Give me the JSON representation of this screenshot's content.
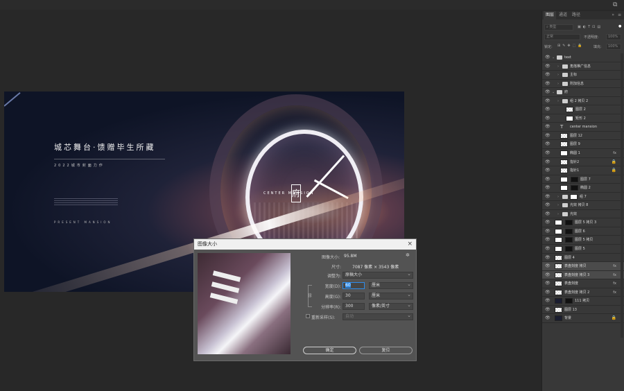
{
  "canvas": {
    "title": "城芯舞台·馈赠毕生所藏",
    "subtitle": "2022城市封面力作",
    "center_text": "CENTER MANSION",
    "logo_char": "府",
    "tagline": "PRESENT MANSION"
  },
  "dialog": {
    "title": "图像大小",
    "close": "×",
    "image_size_label": "图像大小:",
    "image_size_value": "95.8M",
    "dimensions_label": "尺寸:",
    "dimensions_value": "7087 像素  ×  3543 像素",
    "fit_label": "调整为:",
    "fit_value": "原稿大小",
    "width_label": "宽度(D):",
    "width_value": "60",
    "width_unit": "厘米",
    "height_label": "高度(G):",
    "height_value": "30",
    "height_unit": "厘米",
    "resolution_label": "分辨率(R):",
    "resolution_value": "300",
    "resolution_unit": "像素/英寸",
    "resample_label": "重新采样(S):",
    "resample_value": "自动",
    "ok": "确定",
    "cancel": "复位"
  },
  "panel": {
    "tabs": [
      "图层",
      "通道",
      "路径"
    ],
    "search_placeholder": "类型",
    "blend_mode": "正常",
    "opacity_label": "不透明度:",
    "opacity_value": "100%",
    "lock_label": "锁定:",
    "fill_label": "填充:",
    "fill_value": "100%",
    "layers": [
      {
        "name": "text",
        "type": "group-open"
      },
      {
        "name": "角落推广信息",
        "type": "group"
      },
      {
        "name": "主标",
        "type": "group"
      },
      {
        "name": "附加信息",
        "type": "group"
      },
      {
        "name": "府",
        "type": "group-open"
      },
      {
        "name": "组 2 拷贝 2",
        "type": "group"
      },
      {
        "name": "图层 2",
        "type": "layer"
      },
      {
        "name": "矩形 2",
        "type": "shape"
      },
      {
        "name": "center   mansion",
        "type": "text"
      },
      {
        "name": "图层 12",
        "type": "layer"
      },
      {
        "name": "图层 9",
        "type": "layer"
      },
      {
        "name": "椭圆 1",
        "type": "shape"
      },
      {
        "name": "指针2",
        "type": "layer"
      },
      {
        "name": "指针1",
        "type": "layer"
      },
      {
        "name": "图层 7",
        "type": "masked"
      },
      {
        "name": "椭圆 2",
        "type": "masked"
      },
      {
        "name": "组 7",
        "type": "group-mask"
      },
      {
        "name": "光效 拷贝 8",
        "type": "group"
      },
      {
        "name": "光效",
        "type": "group"
      },
      {
        "name": "图层 5 拷贝 3",
        "type": "masked"
      },
      {
        "name": "图层 6",
        "type": "masked"
      },
      {
        "name": "图层 5 拷贝",
        "type": "masked"
      },
      {
        "name": "图层 5",
        "type": "masked"
      },
      {
        "name": "图层 4",
        "type": "layer"
      },
      {
        "name": "表盘刻度 拷贝",
        "type": "fx"
      },
      {
        "name": "表盘刻度 拷贝 3",
        "type": "fx"
      },
      {
        "name": "表盘刻度",
        "type": "fx"
      },
      {
        "name": "表盘刻度 拷贝 2",
        "type": "fx"
      },
      {
        "name": "111 拷贝",
        "type": "masked"
      },
      {
        "name": "图层 13",
        "type": "layer"
      },
      {
        "name": "背景",
        "type": "background"
      }
    ],
    "fx_label": "fx"
  }
}
